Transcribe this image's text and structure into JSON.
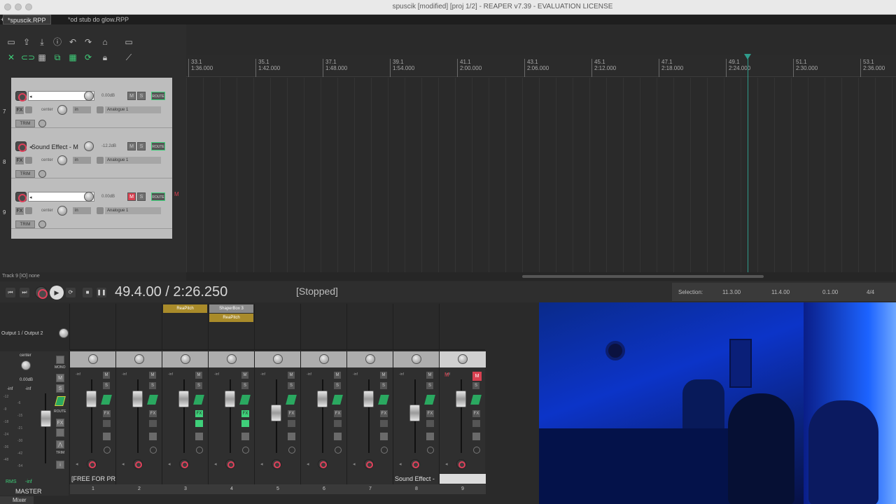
{
  "window": {
    "title": "spuscik [modified] [proj 1/2] - REAPER v7.39 - EVALUATION LICENSE"
  },
  "project_tabs": [
    {
      "label": "*spuscik.RPP"
    },
    {
      "label": "*od stub do glow.RPP"
    }
  ],
  "ruler": [
    {
      "bar": "33.1",
      "time": "1:36.000"
    },
    {
      "bar": "35.1",
      "time": "1:42.000"
    },
    {
      "bar": "37.1",
      "time": "1:48.000"
    },
    {
      "bar": "39.1",
      "time": "1:54.000"
    },
    {
      "bar": "41.1",
      "time": "2:00.000"
    },
    {
      "bar": "43.1",
      "time": "2:06.000"
    },
    {
      "bar": "45.1",
      "time": "2:12.000"
    },
    {
      "bar": "47.1",
      "time": "2:18.000"
    },
    {
      "bar": "49.1",
      "time": "2:24.000"
    },
    {
      "bar": "51.1",
      "time": "2:30.000"
    },
    {
      "bar": "53.1",
      "time": "2:36.000"
    }
  ],
  "tracks": [
    {
      "num": "7",
      "name": "",
      "volume": "0.00dB",
      "pan": "center",
      "input_mode": "in",
      "input": "Analogue 1",
      "mute": "M",
      "solo": "S",
      "route": "ROUTE",
      "fx": "FX",
      "trim": "TRIM"
    },
    {
      "num": "8",
      "name": "Sound Effect - M",
      "volume": "-12.2dB",
      "pan": "center",
      "input_mode": "in",
      "input": "Analogue 1",
      "mute": "M",
      "solo": "S",
      "route": "ROUTE",
      "fx": "FX",
      "trim": "TRIM"
    },
    {
      "num": "9",
      "name": "",
      "volume": "0.00dB",
      "pan": "center",
      "input_mode": "in",
      "input": "Analogue 1",
      "mute": "M",
      "solo": "S",
      "route": "ROUTE",
      "fx": "FX",
      "trim": "TRIM"
    }
  ],
  "status_line": "Track 9 [IO] none",
  "transport": {
    "time": "49.4.00 / 2:26.250",
    "state": "[Stopped]",
    "selection_label": "Selection:",
    "selection_start": "11.3.00",
    "selection_end": "11.4.00",
    "selection_length": "0.1.00",
    "time_signature": "4/4"
  },
  "mixer": {
    "output_label": "Output 1 / Output 2",
    "master": {
      "pan": "center",
      "volume": "0.00dB",
      "peak_l": "-inf",
      "peak_r": "-inf",
      "meter_mode": "RMS",
      "meter_value": "-inf",
      "name": "MASTER",
      "mono": "MONO",
      "mute": "M",
      "solo": "S",
      "fx": "FX",
      "route": "ROUTE",
      "trim": "TRIM",
      "scale": [
        "-12",
        "-6",
        "-9",
        "-15",
        "-18",
        "-21",
        "-24",
        "-30",
        "-36",
        "-42",
        "-48",
        "-54"
      ]
    },
    "fx_slots": [
      {
        "strip": 3,
        "label": "ReaPitch"
      },
      {
        "strip": 4,
        "label": "ShaperBox 3"
      },
      {
        "strip": 4,
        "label": "ReaPitch"
      }
    ],
    "strips": [
      {
        "num": "1",
        "name": "[FREE FOR PR",
        "vol": "-inf",
        "mute": "M",
        "solo": "S",
        "fx": "FX"
      },
      {
        "num": "2",
        "name": "",
        "vol": "-inf",
        "mute": "M",
        "solo": "S",
        "fx": "FX"
      },
      {
        "num": "3",
        "name": "",
        "vol": "-inf",
        "mute": "M",
        "solo": "S",
        "fx": "FX"
      },
      {
        "num": "4",
        "name": "",
        "vol": "-inf",
        "mute": "M",
        "solo": "S",
        "fx": "FX"
      },
      {
        "num": "5",
        "name": "",
        "vol": "-inf",
        "mute": "M",
        "solo": "S",
        "fx": "FX"
      },
      {
        "num": "6",
        "name": "",
        "vol": "-inf",
        "mute": "M",
        "solo": "S",
        "fx": "FX"
      },
      {
        "num": "7",
        "name": "",
        "vol": "-inf",
        "mute": "M",
        "solo": "S",
        "fx": "FX"
      },
      {
        "num": "8",
        "name": "Sound Effect -",
        "vol": "-inf",
        "mute": "M",
        "solo": "S",
        "fx": "FX"
      },
      {
        "num": "9",
        "name": "",
        "vol": "-inf",
        "mute": "M",
        "solo": "S",
        "fx": "FX"
      }
    ],
    "tab_label": "Mixer"
  },
  "colors": {
    "accent_green": "#3fd07a",
    "record_red": "#e0405a",
    "mute_red": "#d84050",
    "fx_yellow": "#a98b2a",
    "playhead": "#2f9c8c"
  }
}
